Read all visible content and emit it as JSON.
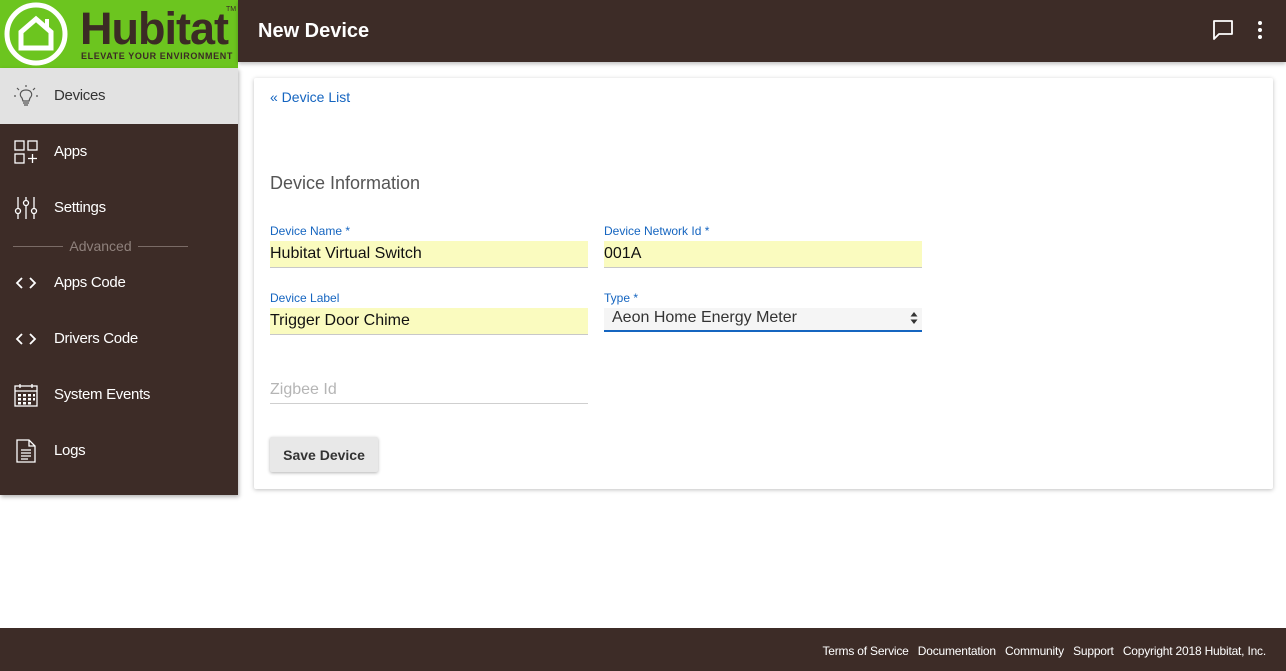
{
  "brand": {
    "name": "Hubitat",
    "tagline": "ELEVATE YOUR ENVIRONMENT",
    "trademark": "TM",
    "color": "#6cc51f"
  },
  "header": {
    "title": "New Device",
    "bg_color": "#3d2c27",
    "icons": [
      "chat-icon",
      "more-vert-icon"
    ]
  },
  "sidebar": {
    "items": [
      {
        "label": "Devices",
        "icon": "lightbulb-icon",
        "active": true
      },
      {
        "label": "Apps",
        "icon": "apps-grid-icon"
      },
      {
        "label": "Settings",
        "icon": "sliders-icon"
      },
      {
        "label": "Apps Code",
        "icon": "code-icon"
      },
      {
        "label": "Drivers Code",
        "icon": "code-icon"
      },
      {
        "label": "System Events",
        "icon": "calendar-icon"
      },
      {
        "label": "Logs",
        "icon": "document-icon"
      }
    ],
    "section_divider": "Advanced"
  },
  "main": {
    "back_link": "« Device List",
    "section_title": "Device Information",
    "fields": {
      "device_name": {
        "label": "Device Name *",
        "value": "Hubitat Virtual Switch"
      },
      "device_network_id": {
        "label": "Device Network Id *",
        "value": "001A"
      },
      "device_label": {
        "label": "Device Label",
        "value": "Trigger Door Chime"
      },
      "type": {
        "label": "Type *",
        "value": "Aeon Home Energy Meter"
      },
      "zigbee_id": {
        "placeholder": "Zigbee Id",
        "value": ""
      }
    },
    "save_button": "Save Device"
  },
  "footer": {
    "links": [
      "Terms of Service",
      "Documentation",
      "Community",
      "Support"
    ],
    "copyright": "Copyright 2018 Hubitat, Inc."
  }
}
